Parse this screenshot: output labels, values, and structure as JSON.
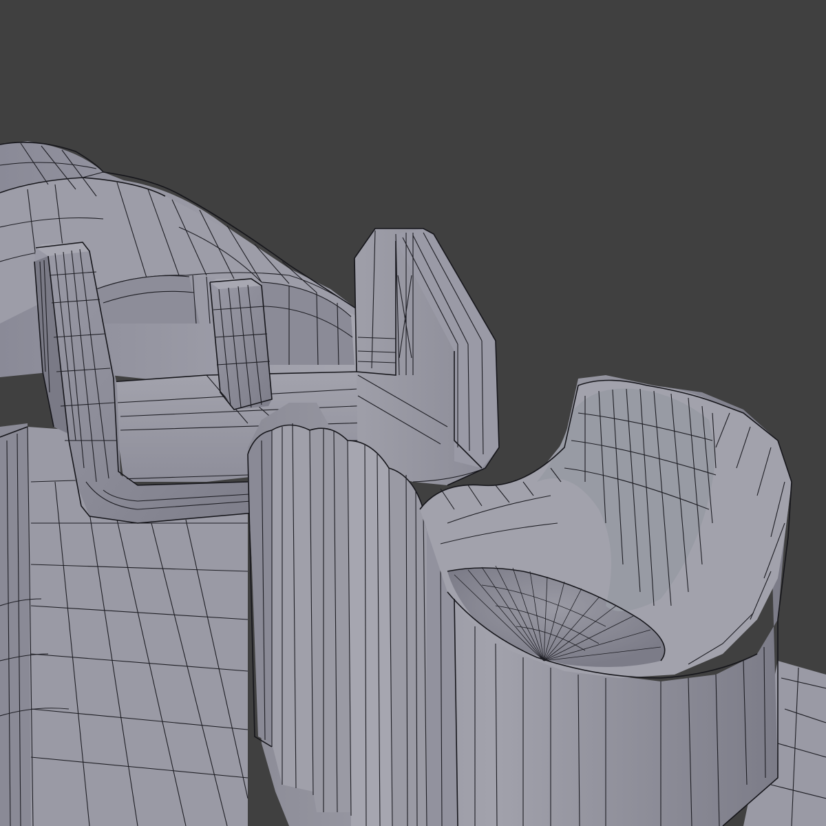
{
  "viewport": {
    "background_color": "#404040",
    "mesh_base_color": "#8c8c98",
    "mesh_light_color": "#a4a4ae",
    "mesh_dark_color": "#6e6e7a",
    "wire_color": "#1c1c22"
  },
  "objects": [
    {
      "name": "housing-body"
    },
    {
      "name": "left-bracket"
    },
    {
      "name": "center-post"
    },
    {
      "name": "right-fin"
    },
    {
      "name": "channel-floor"
    },
    {
      "name": "fluted-cylinder-cup"
    },
    {
      "name": "base-plate"
    }
  ]
}
